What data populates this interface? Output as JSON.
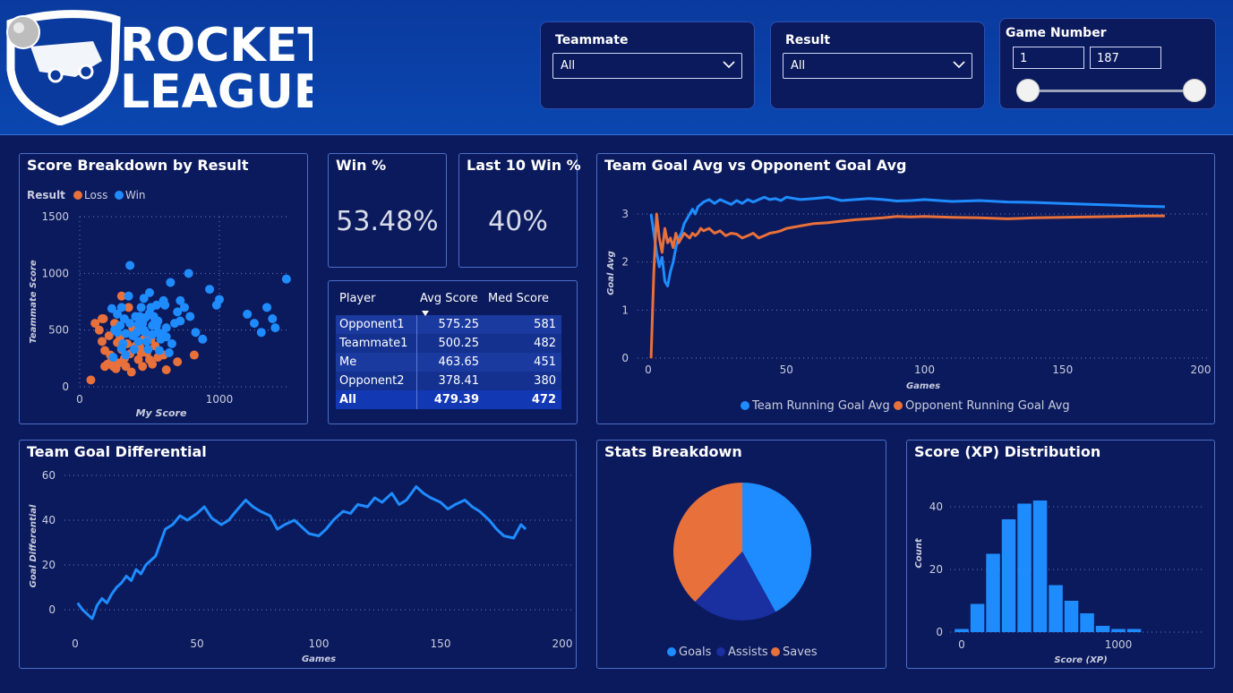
{
  "header": {
    "logo_line1": "ROCKET",
    "logo_line2": "LEAGUE"
  },
  "filters": {
    "teammate": {
      "label": "Teammate",
      "value": "All"
    },
    "result": {
      "label": "Result",
      "value": "All"
    },
    "game_number": {
      "label": "Game Number",
      "min": "1",
      "max": "187"
    }
  },
  "kpis": {
    "win_pct": {
      "label": "Win %",
      "value": "53.48%"
    },
    "last10": {
      "label": "Last 10 Win %",
      "value": "40%"
    }
  },
  "player_table": {
    "headers": [
      "Player",
      "Avg Score",
      "Med Score"
    ],
    "rows": [
      [
        "Opponent1",
        "575.25",
        "581"
      ],
      [
        "Teammate1",
        "500.25",
        "482"
      ],
      [
        "Me",
        "463.65",
        "451"
      ],
      [
        "Opponent2",
        "378.41",
        "380"
      ]
    ],
    "total": [
      "All",
      "479.39",
      "472"
    ]
  },
  "colors": {
    "team": "#1e8cff",
    "opponent": "#e8703a",
    "assists": "#1a2fa0",
    "background": "#0b1a5c"
  },
  "chart_data": [
    {
      "id": "scatter",
      "type": "scatter",
      "title": "Score Breakdown by Result",
      "legend_title": "Result",
      "xlabel": "My Score",
      "ylabel": "Teammate Score",
      "xlim": [
        0,
        1500
      ],
      "ylim": [
        0,
        1500
      ],
      "xticks": [
        0,
        1000
      ],
      "yticks": [
        0,
        500,
        1000,
        1500
      ],
      "series": [
        {
          "name": "Loss",
          "points": [
            [
              140,
              500
            ],
            [
              160,
              400
            ],
            [
              180,
              320
            ],
            [
              200,
              200
            ],
            [
              220,
              280
            ],
            [
              240,
              180
            ],
            [
              260,
              160
            ],
            [
              280,
              210
            ],
            [
              300,
              330
            ],
            [
              320,
              250
            ],
            [
              340,
              380
            ],
            [
              360,
              290
            ],
            [
              380,
              520
            ],
            [
              400,
              360
            ],
            [
              420,
              240
            ],
            [
              440,
              300
            ],
            [
              460,
              420
            ],
            [
              480,
              300
            ],
            [
              520,
              200
            ],
            [
              560,
              260
            ],
            [
              600,
              280
            ],
            [
              700,
              220
            ],
            [
              820,
              280
            ],
            [
              80,
              60
            ],
            [
              110,
              560
            ],
            [
              170,
              600
            ],
            [
              210,
              450
            ],
            [
              250,
              560
            ],
            [
              290,
              440
            ],
            [
              330,
              180
            ],
            [
              370,
              130
            ],
            [
              450,
              180
            ],
            [
              500,
              240
            ],
            [
              540,
              360
            ],
            [
              620,
              150
            ],
            [
              180,
              180
            ],
            [
              230,
              230
            ],
            [
              270,
              390
            ],
            [
              350,
              700
            ],
            [
              390,
              470
            ],
            [
              430,
              350
            ],
            [
              510,
              420
            ],
            [
              160,
              600
            ],
            [
              300,
              800
            ]
          ]
        },
        {
          "name": "Win",
          "points": [
            [
              300,
              700
            ],
            [
              320,
              600
            ],
            [
              350,
              800
            ],
            [
              380,
              450
            ],
            [
              400,
              620
            ],
            [
              420,
              550
            ],
            [
              440,
              700
            ],
            [
              460,
              500
            ],
            [
              480,
              400
            ],
            [
              500,
              650
            ],
            [
              520,
              540
            ],
            [
              540,
              580
            ],
            [
              560,
              480
            ],
            [
              580,
              420
            ],
            [
              600,
              760
            ],
            [
              620,
              520
            ],
            [
              640,
              300
            ],
            [
              660,
              380
            ],
            [
              680,
              560
            ],
            [
              700,
              660
            ],
            [
              720,
              580
            ],
            [
              750,
              700
            ],
            [
              790,
              620
            ],
            [
              830,
              480
            ],
            [
              880,
              420
            ],
            [
              1200,
              640
            ],
            [
              1250,
              560
            ],
            [
              1300,
              480
            ],
            [
              1400,
              520
            ],
            [
              1480,
              950
            ],
            [
              270,
              640
            ],
            [
              290,
              540
            ],
            [
              310,
              380
            ],
            [
              330,
              470
            ],
            [
              360,
              560
            ],
            [
              390,
              330
            ],
            [
              410,
              480
            ],
            [
              430,
              620
            ],
            [
              450,
              560
            ],
            [
              470,
              480
            ],
            [
              490,
              330
            ],
            [
              510,
              700
            ],
            [
              530,
              620
            ],
            [
              550,
              540
            ],
            [
              570,
              320
            ],
            [
              590,
              470
            ],
            [
              610,
              720
            ],
            [
              650,
              920
            ],
            [
              780,
              1000
            ],
            [
              930,
              860
            ],
            [
              1000,
              770
            ],
            [
              230,
              690
            ],
            [
              250,
              500
            ],
            [
              270,
              480
            ],
            [
              240,
              260
            ],
            [
              360,
              1070
            ],
            [
              460,
              780
            ],
            [
              500,
              830
            ],
            [
              550,
              720
            ],
            [
              300,
              340
            ],
            [
              330,
              280
            ],
            [
              420,
              400
            ],
            [
              470,
              610
            ],
            [
              520,
              460
            ],
            [
              560,
              580
            ],
            [
              620,
              440
            ],
            [
              720,
              760
            ],
            [
              980,
              720
            ],
            [
              1340,
              700
            ],
            [
              1380,
              600
            ]
          ]
        }
      ]
    },
    {
      "id": "goalavg",
      "type": "line",
      "title": "Team Goal Avg vs Opponent Goal Avg",
      "xlabel": "Games",
      "ylabel": "Goal Avg",
      "xlim": [
        0,
        200
      ],
      "ylim": [
        0,
        3.5
      ],
      "xticks": [
        0,
        50,
        100,
        150,
        200
      ],
      "yticks": [
        0,
        1,
        2,
        3
      ],
      "x": [
        1,
        2,
        3,
        4,
        5,
        6,
        7,
        8,
        9,
        10,
        11,
        12,
        13,
        14,
        15,
        16,
        17,
        18,
        19,
        20,
        22,
        24,
        26,
        28,
        30,
        32,
        34,
        36,
        38,
        40,
        42,
        44,
        46,
        48,
        50,
        55,
        60,
        65,
        70,
        75,
        80,
        85,
        90,
        95,
        100,
        110,
        120,
        130,
        140,
        150,
        160,
        170,
        180,
        187
      ],
      "series": [
        {
          "name": "Team Running Goal Avg",
          "values": [
            3.0,
            2.6,
            2.2,
            1.9,
            2.1,
            1.6,
            1.5,
            1.8,
            2.0,
            2.3,
            2.5,
            2.6,
            2.8,
            2.9,
            3.0,
            3.1,
            3.0,
            3.15,
            3.2,
            3.25,
            3.3,
            3.22,
            3.3,
            3.25,
            3.2,
            3.28,
            3.22,
            3.3,
            3.25,
            3.3,
            3.35,
            3.3,
            3.32,
            3.28,
            3.35,
            3.3,
            3.32,
            3.35,
            3.28,
            3.3,
            3.32,
            3.3,
            3.27,
            3.28,
            3.3,
            3.26,
            3.28,
            3.25,
            3.24,
            3.22,
            3.2,
            3.18,
            3.16,
            3.15
          ]
        },
        {
          "name": "Opponent Running Goal Avg",
          "values": [
            0.0,
            1.8,
            3.0,
            2.5,
            2.2,
            2.7,
            2.4,
            2.5,
            2.3,
            2.6,
            2.4,
            2.5,
            2.6,
            2.55,
            2.5,
            2.6,
            2.55,
            2.6,
            2.7,
            2.65,
            2.7,
            2.6,
            2.65,
            2.55,
            2.6,
            2.58,
            2.5,
            2.55,
            2.6,
            2.5,
            2.55,
            2.6,
            2.62,
            2.65,
            2.7,
            2.75,
            2.8,
            2.82,
            2.85,
            2.88,
            2.9,
            2.92,
            2.95,
            2.94,
            2.95,
            2.93,
            2.92,
            2.9,
            2.92,
            2.93,
            2.94,
            2.95,
            2.96,
            2.96
          ]
        }
      ]
    },
    {
      "id": "diff",
      "type": "line",
      "title": "Team Goal Differential",
      "xlabel": "Games",
      "ylabel": "Goal Differential",
      "xlim": [
        0,
        200
      ],
      "ylim": [
        -8,
        64
      ],
      "xticks": [
        0,
        50,
        100,
        150,
        200
      ],
      "yticks": [
        0,
        20,
        40,
        60
      ],
      "x": [
        1,
        3,
        5,
        7,
        9,
        11,
        13,
        15,
        17,
        19,
        21,
        23,
        25,
        27,
        29,
        31,
        33,
        35,
        37,
        40,
        43,
        46,
        50,
        53,
        56,
        60,
        63,
        66,
        70,
        73,
        76,
        80,
        83,
        86,
        90,
        93,
        96,
        100,
        103,
        106,
        110,
        113,
        116,
        120,
        123,
        126,
        130,
        133,
        136,
        140,
        143,
        146,
        150,
        153,
        156,
        160,
        163,
        166,
        170,
        173,
        176,
        180,
        183,
        185
      ],
      "series": [
        {
          "name": "Team Goal Differential",
          "values": [
            3,
            0,
            -2,
            -4,
            2,
            5,
            3,
            7,
            10,
            12,
            15,
            13,
            18,
            16,
            20,
            22,
            24,
            30,
            36,
            38,
            42,
            40,
            43,
            46,
            41,
            38,
            40,
            44,
            49,
            46,
            44,
            42,
            36,
            38,
            40,
            37,
            34,
            33,
            36,
            40,
            44,
            43,
            47,
            46,
            50,
            48,
            52,
            47,
            49,
            55,
            52,
            50,
            48,
            45,
            47,
            49,
            46,
            44,
            40,
            36,
            33,
            32,
            38,
            36
          ]
        }
      ]
    },
    {
      "id": "pie",
      "type": "pie",
      "title": "Stats Breakdown",
      "categories": [
        "Goals",
        "Assists",
        "Saves"
      ],
      "values": [
        42,
        20,
        38
      ]
    },
    {
      "id": "hist",
      "type": "bar",
      "title": "Score (XP) Distribution",
      "xlabel": "Score (XP)",
      "ylabel": "Count",
      "xticks": [
        0,
        1000
      ],
      "yticks": [
        0,
        20,
        40
      ],
      "bin_width": 100,
      "bin_starts": [
        0,
        100,
        200,
        300,
        400,
        500,
        600,
        700,
        800,
        900,
        1000,
        1100
      ],
      "values": [
        1,
        9,
        25,
        36,
        41,
        42,
        15,
        10,
        6,
        2,
        1,
        1
      ]
    }
  ]
}
